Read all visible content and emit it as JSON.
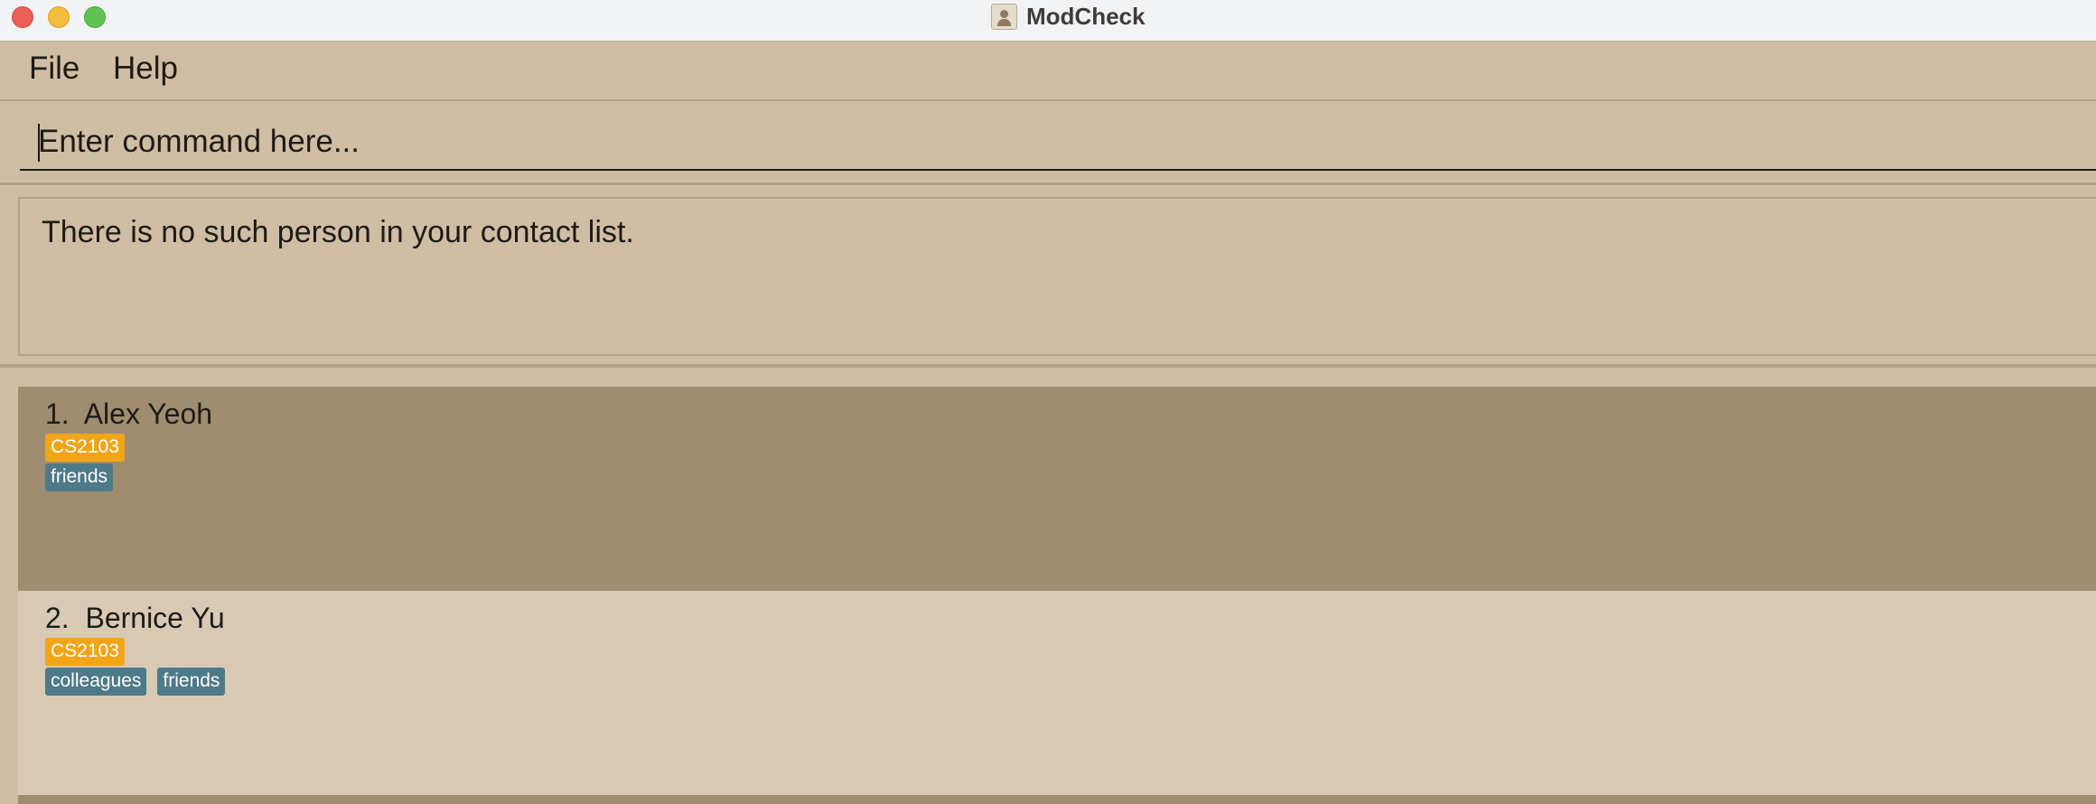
{
  "window": {
    "title": "ModCheck",
    "icon": "contacts-app-icon"
  },
  "menu": {
    "items": [
      "File",
      "Help"
    ]
  },
  "command": {
    "placeholder": "Enter command here...",
    "value": ""
  },
  "result": {
    "message": "There is no such person in your contact list."
  },
  "persons": [
    {
      "label": "1.  Alex Yeoh",
      "modules": [
        "CS2103"
      ],
      "tags": [
        "friends"
      ]
    },
    {
      "label": "2.  Bernice Yu",
      "modules": [
        "CS2103"
      ],
      "tags": [
        "colleagues",
        "friends"
      ]
    }
  ],
  "colors": {
    "background": "#cfbea4",
    "selected_card": "#9e8d71",
    "card": "#d8cab5",
    "module_tag": "#f3a518",
    "tag": "#4d7a89"
  }
}
